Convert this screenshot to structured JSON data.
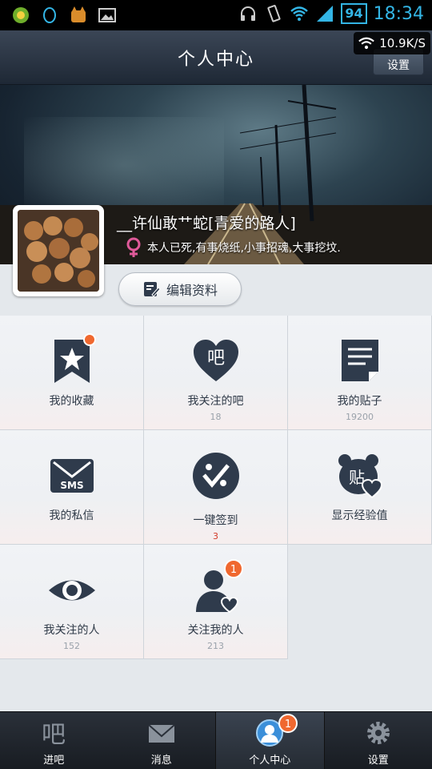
{
  "status_bar": {
    "battery": "94",
    "time": "18:34",
    "net_speed": "10.9K/S"
  },
  "header": {
    "title": "个人中心",
    "settings_button": "设置"
  },
  "profile": {
    "username": "__许仙敢艹蛇[青爱的路人]",
    "bio": "本人已死,有事烧纸,小事招魂,大事挖坟.",
    "edit_button": "编辑资料"
  },
  "grid": [
    {
      "label": "我的收藏",
      "count": "",
      "icon": "bookmark-star-icon",
      "dot": true
    },
    {
      "label": "我关注的吧",
      "count": "18",
      "icon": "heart-ba-icon"
    },
    {
      "label": "我的贴子",
      "count": "19200",
      "icon": "document-icon"
    },
    {
      "label": "我的私信",
      "count": "",
      "icon": "sms-envelope-icon"
    },
    {
      "label": "一键签到",
      "count": "3",
      "icon": "sign-in-paw-icon"
    },
    {
      "label": "显示经验值",
      "count": "",
      "icon": "bear-tie-heart-icon"
    },
    {
      "label": "我关注的人",
      "count": "152",
      "icon": "eye-icon"
    },
    {
      "label": "关注我的人",
      "count": "213",
      "icon": "follower-person-icon",
      "badge": "1"
    }
  ],
  "bottom_nav": [
    {
      "label": "进吧",
      "icon": "ba-icon"
    },
    {
      "label": "消息",
      "icon": "mail-icon"
    },
    {
      "label": "个人中心",
      "icon": "user-icon",
      "badge": "1",
      "active": true
    },
    {
      "label": "设置",
      "icon": "gear-icon"
    }
  ],
  "colors": {
    "accent_badge": "#f0682f",
    "icon_dark": "#2f3b4c",
    "status_blue": "#33b5e5",
    "female_pink": "#e05a9a"
  }
}
